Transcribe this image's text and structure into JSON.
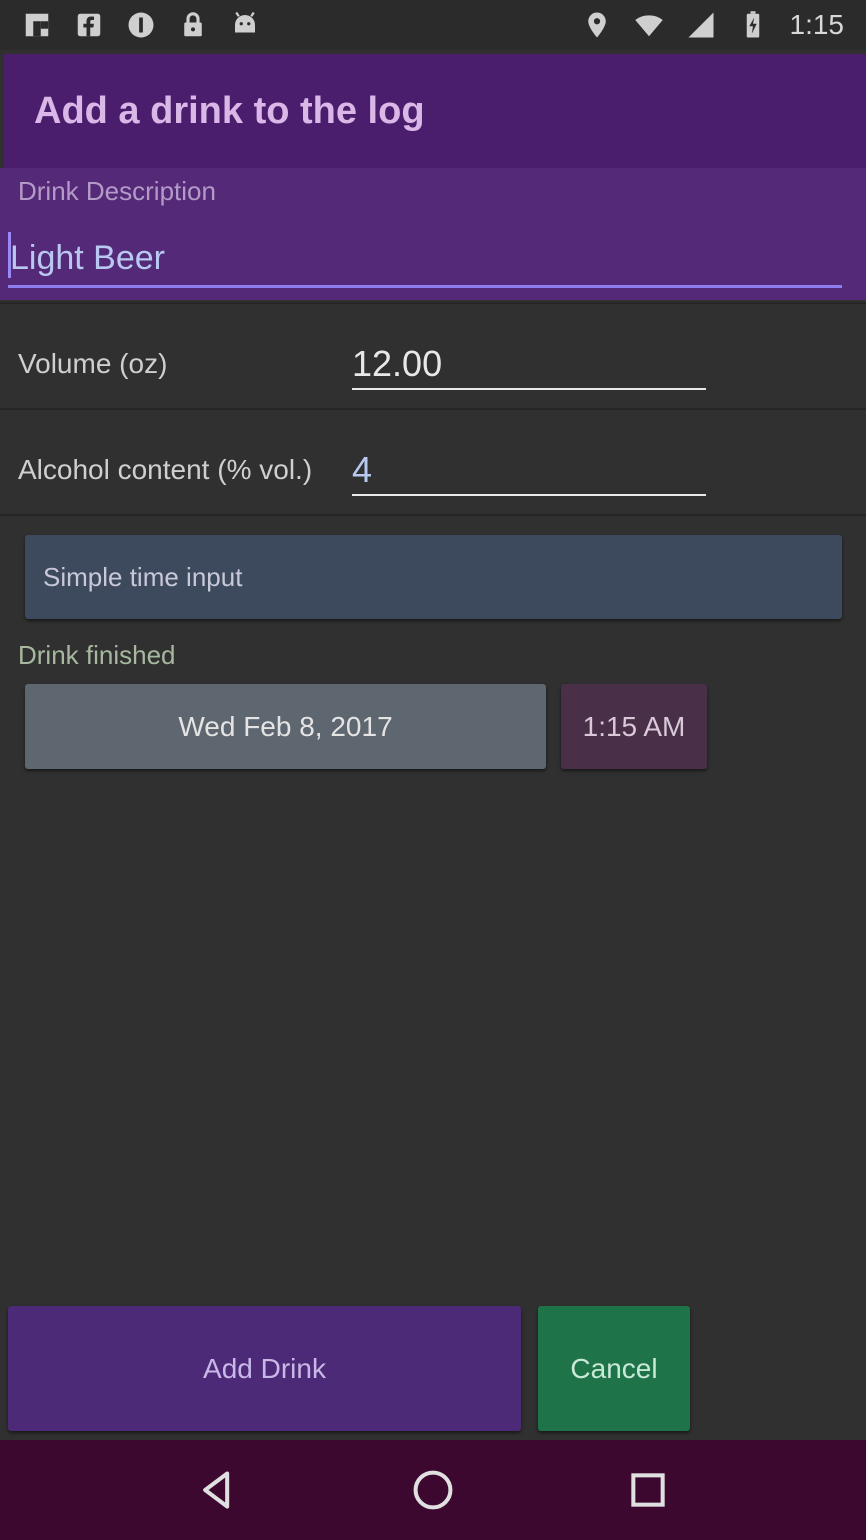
{
  "status_bar": {
    "left_icons": [
      "flipboard-icon",
      "facebook-icon",
      "info-circle-icon",
      "lock-icon",
      "android-icon"
    ],
    "right_icons": [
      "location-pin-icon",
      "wifi-icon",
      "signal-icon",
      "battery-charging-icon"
    ],
    "time": "1:15"
  },
  "dialog": {
    "title": "Add a drink to the log",
    "description": {
      "label": "Drink Description",
      "value": "Light Beer"
    },
    "volume": {
      "label": "Volume (oz)",
      "value": "12.00"
    },
    "alcohol": {
      "label": "Alcohol content (% vol.)",
      "value": "4"
    },
    "simple_time_button": "Simple time input",
    "drink_finished_label": "Drink finished",
    "date_button": "Wed Feb 8, 2017",
    "time_button": "1:15 AM",
    "add_button": "Add Drink",
    "cancel_button": "Cancel"
  },
  "nav_bar": {
    "buttons": [
      "back-icon",
      "home-icon",
      "recents-icon"
    ]
  },
  "colors": {
    "title_bar": "#4a1e6d",
    "description_block": "#542a78",
    "add_button": "#4d2a78",
    "cancel_button": "#1e7448",
    "nav_bar": "#3d0830"
  }
}
